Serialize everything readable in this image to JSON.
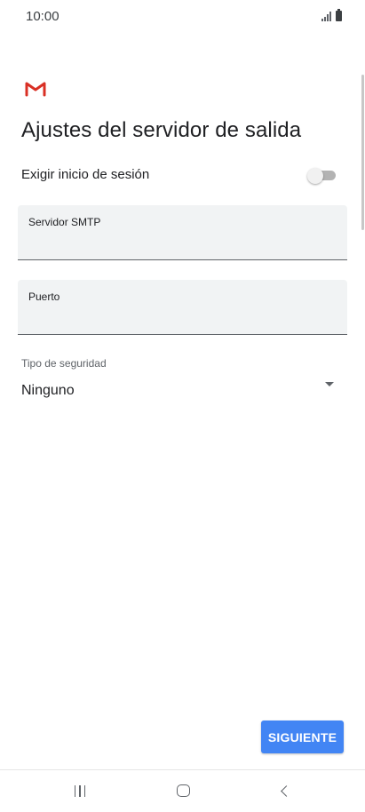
{
  "status_bar": {
    "time": "10:00",
    "icons": [
      "signal-icon",
      "battery-icon"
    ]
  },
  "header": {
    "logo_icon": "gmail-logo-icon",
    "title": "Ajustes del servidor de salida"
  },
  "form": {
    "require_login_label": "Exigir inicio de sesión",
    "require_login_enabled": false,
    "smtp_server_label": "Servidor SMTP",
    "smtp_server_value": "",
    "port_label": "Puerto",
    "port_value": "",
    "security_type_label": "Tipo de seguridad",
    "security_type_value": "Ninguno"
  },
  "actions": {
    "next_label": "SIGUIENTE"
  },
  "navigation": {
    "recents_icon": "recents-icon",
    "home_icon": "home-icon",
    "back_icon": "back-icon"
  },
  "colors": {
    "accent": "#4285f4",
    "gmail_red": "#d93025",
    "field_background": "#f1f3f4"
  }
}
